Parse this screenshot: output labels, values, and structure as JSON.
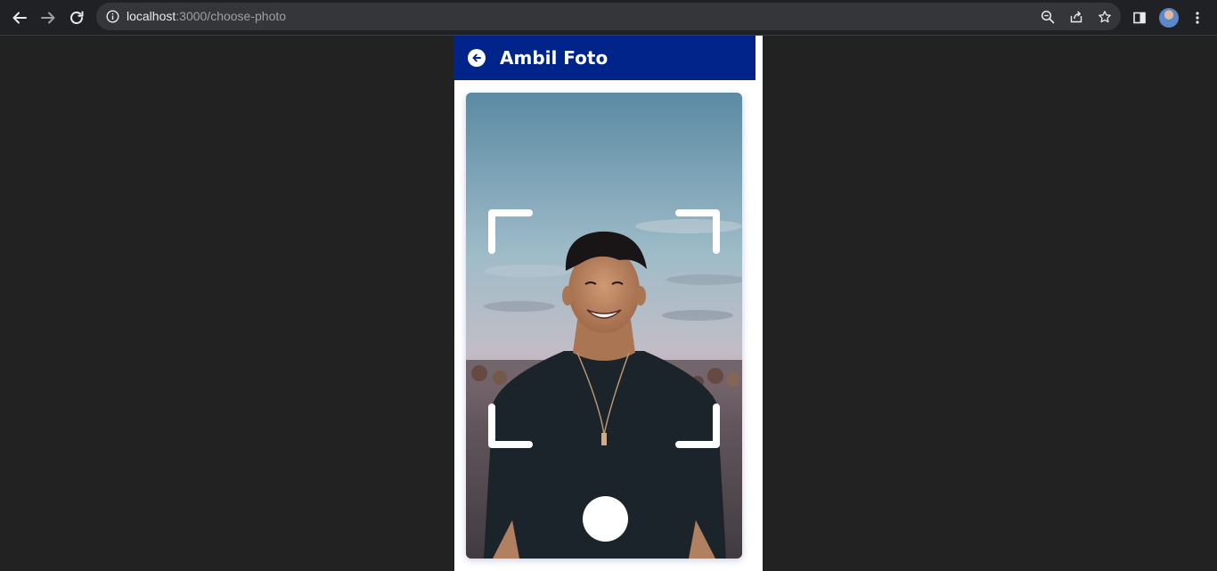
{
  "browser": {
    "url_host": "localhost",
    "url_path": ":3000/choose-photo",
    "icons": [
      "back-arrow-icon",
      "forward-arrow-icon",
      "reload-icon",
      "info-icon",
      "zoom-icon",
      "share-icon",
      "star-icon",
      "side-panel-icon",
      "profile-avatar",
      "more-menu-icon"
    ]
  },
  "app": {
    "title": "Ambil Foto",
    "header_color": "#00248a",
    "back_icon": "arrow-left-circle-icon",
    "shutter_icon": "camera-shutter-button"
  }
}
